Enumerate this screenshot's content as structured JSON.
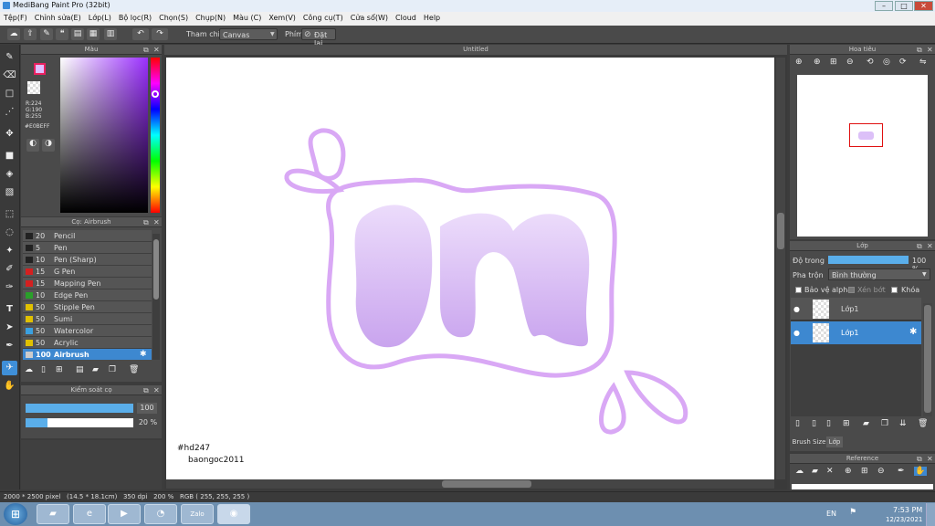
{
  "app": {
    "title": "MediBang Paint Pro (32bit)"
  },
  "window_controls": {
    "minimize": "–",
    "maximize": "□",
    "close": "✕"
  },
  "menu": [
    "Tệp(F)",
    "Chỉnh sửa(E)",
    "Lớp(L)",
    "Bộ lọc(R)",
    "Chọn(S)",
    "Chụp(N)",
    "Màu (C)",
    "Xem(V)",
    "Công cụ(T)",
    "Cửa sổ(W)",
    "Cloud",
    "Help"
  ],
  "toolbar": {
    "reference_label": "Tham chiếu",
    "reference_value": "Canvas",
    "key_label": "Phím",
    "reset_label": "Đặt lại"
  },
  "color_panel": {
    "title": "Màu",
    "r": "R:224",
    "g": "G:190",
    "b": "B:255",
    "hex": "#E0BEFF",
    "fg_color": "#e0beff"
  },
  "brush_panel": {
    "title": "Cọ: Airbrush",
    "brushes": [
      {
        "size": "20",
        "name": "Pencil",
        "color": "#222222"
      },
      {
        "size": "5",
        "name": "Pen",
        "color": "#222222"
      },
      {
        "size": "10",
        "name": "Pen (Sharp)",
        "color": "#222222"
      },
      {
        "size": "15",
        "name": "G Pen",
        "color": "#d42020"
      },
      {
        "size": "15",
        "name": "Mapping Pen",
        "color": "#d42020"
      },
      {
        "size": "10",
        "name": "Edge Pen",
        "color": "#2aa02a"
      },
      {
        "size": "50",
        "name": "Stipple Pen",
        "color": "#e0c000"
      },
      {
        "size": "50",
        "name": "Sumi",
        "color": "#e0c000"
      },
      {
        "size": "50",
        "name": "Watercolor",
        "color": "#3aa0e0"
      },
      {
        "size": "50",
        "name": "Acrylic",
        "color": "#e0c000"
      },
      {
        "size": "100",
        "name": "Airbrush",
        "color": "#cccccc"
      }
    ],
    "selected_index": 10
  },
  "brush_control": {
    "title": "Kiểm soát cọ",
    "size_value": "100",
    "opacity_value": "20 %",
    "size_fraction": 1.0,
    "opacity_fraction": 0.2
  },
  "canvas": {
    "tab_title": "Untitled",
    "signature_1": "#hd247",
    "signature_2": "baongoc2011",
    "stroke_color": "#d9a8f5",
    "fill_top": "#ecdcfb",
    "fill_bottom": "#c9a4ee"
  },
  "navigator": {
    "title": "Hoa tiêu"
  },
  "layer_panel": {
    "title": "Lớp",
    "opacity_label": "Độ trong",
    "opacity_value": "100 %",
    "blend_label": "Pha trộn",
    "blend_value": "Bình thường",
    "protect_alpha": "Bảo vệ alpha",
    "clipping": "Xén bớt",
    "lock": "Khóa",
    "layers": [
      {
        "name": "Lớp1",
        "selected": false
      },
      {
        "name": "Lớp1",
        "selected": true
      }
    ],
    "tabs": [
      "Brush Size",
      "Lớp"
    ]
  },
  "reference_panel": {
    "title": "Reference"
  },
  "status_bar": {
    "text": "2000 * 2500 pixel   (14.5 * 18.1cm)   350 dpi   200 %   RGB ( 255, 255, 255 )"
  },
  "taskbar": {
    "lang": "EN",
    "time": "7:53 PM",
    "date": "12/23/2021",
    "apps": [
      "folder",
      "ie",
      "media",
      "app-green",
      "zalo",
      "chrome"
    ]
  }
}
